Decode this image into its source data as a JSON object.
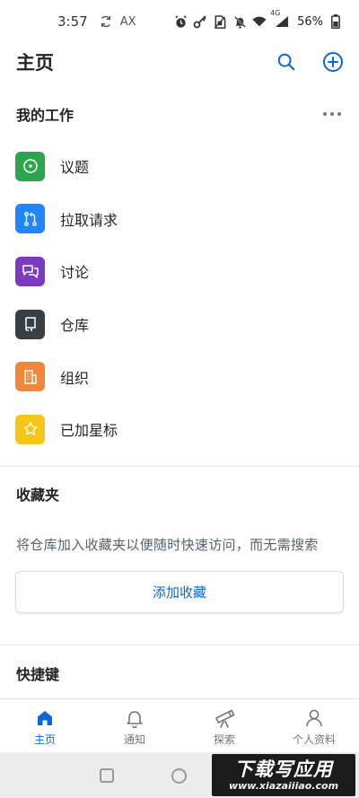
{
  "status_bar": {
    "time": "3:57",
    "carrier_badge": "AX",
    "network": "4G",
    "battery": "56%"
  },
  "header": {
    "title": "主页",
    "search_icon": "search-icon",
    "add_icon": "plus-circle-icon",
    "accent_color": "#0969da"
  },
  "my_work": {
    "title": "我的工作",
    "items": [
      {
        "label": "议题",
        "icon": "issue-icon",
        "color": "#2da44e"
      },
      {
        "label": "拉取请求",
        "icon": "pull-request-icon",
        "color": "#1f86ff"
      },
      {
        "label": "讨论",
        "icon": "discussion-icon",
        "color": "#7c3ac0"
      },
      {
        "label": "仓库",
        "icon": "repo-icon",
        "color": "#3a3f46"
      },
      {
        "label": "组织",
        "icon": "organization-icon",
        "color": "#f0873a"
      },
      {
        "label": "已加星标",
        "icon": "star-icon",
        "color": "#f5c518"
      }
    ]
  },
  "favorites": {
    "title": "收藏夹",
    "description": "将仓库加入收藏夹以便随时快速访问，而无需搜索",
    "button_label": "添加收藏"
  },
  "shortcuts": {
    "title": "快捷键"
  },
  "tabs": [
    {
      "label": "主页",
      "icon": "home-icon",
      "active": true
    },
    {
      "label": "通知",
      "icon": "bell-icon",
      "active": false
    },
    {
      "label": "探索",
      "icon": "telescope-icon",
      "active": false
    },
    {
      "label": "个人资料",
      "icon": "person-icon",
      "active": false
    }
  ],
  "watermark": {
    "title": "下载写应用",
    "url": "www.xiazaiiiao.com"
  }
}
